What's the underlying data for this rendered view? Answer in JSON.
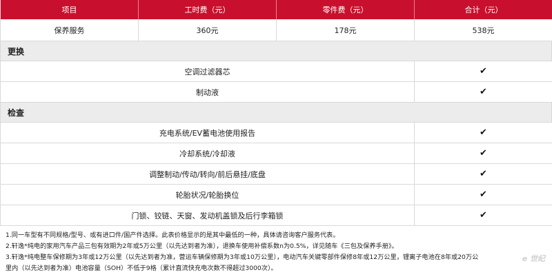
{
  "header": {
    "item": "项目",
    "labor": "工时费（元）",
    "parts": "零件费（元）",
    "total": "合计（元）"
  },
  "service_row": {
    "name": "保养服务",
    "labor": "360元",
    "parts": "178元",
    "total": "538元"
  },
  "replace": {
    "title": "更换",
    "items": [
      {
        "name": "空调过滤器芯",
        "mark": "✔"
      },
      {
        "name": "制动液",
        "mark": "✔"
      }
    ]
  },
  "inspect": {
    "title": "检查",
    "items": [
      {
        "name": "充电系统/EV蓄电池使用报告",
        "mark": "✔"
      },
      {
        "name": "冷却系统/冷却液",
        "mark": "✔"
      },
      {
        "name": "调整制动/传动/转向/前后悬挂/底盘",
        "mark": "✔"
      },
      {
        "name": "轮胎状况/轮胎换位",
        "mark": "✔"
      },
      {
        "name": "门锁、铰链、天窗、发动机盖锁及后行李箱锁",
        "mark": "✔"
      }
    ]
  },
  "notes": [
    "1.同一车型有不同规格/型号、或有进口件/国产件选择。此表价格显示的是其中最低的一种，具体请咨询客户服务代表。",
    "2.轩逸*纯电的家用汽车产品三包有效期为2年或5万公里（以先达到者为准），退换车使用补偿系数n为0.5%，详见随车《三包及保养手册》。",
    "3.轩逸*纯电整车保修期为3年或12万公里（以先达到者为准，营运车辆保修期为3年或10万公里），电动汽车关键零部件保修8年或12万公里，锂离子电池在8年或20万公",
    "里内（以先达到者为准）电池容量（SOH）不低于9格（累计直流快充电次数不得超过3000次）。"
  ],
  "watermark": "e 世纪"
}
